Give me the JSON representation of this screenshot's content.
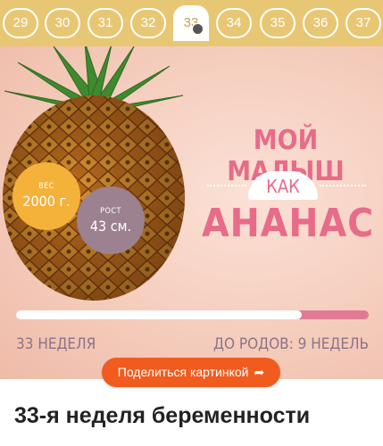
{
  "weeks": {
    "items": [
      "29",
      "30",
      "31",
      "32",
      "33",
      "34",
      "35",
      "36",
      "37"
    ],
    "active": "33"
  },
  "card": {
    "weight": {
      "label": "ВЕС",
      "value": "2000 г."
    },
    "height": {
      "label": "РОСТ",
      "value": "43 см."
    },
    "headline_line1": "МОЙ МАЛЫШ",
    "headline_like": "КАК",
    "headline_fruit": "АНАНАС",
    "progress_fraction": 0.81,
    "week_text": "33 НЕДЕЛЯ",
    "due_text": "ДО РОДОВ: 9 НЕДЕЛЬ"
  },
  "share_button": {
    "label": "Поделиться картинкой",
    "icon": "share-arrow-icon"
  },
  "page_title": "33-я неделя беременности",
  "colors": {
    "week_bar": "#e8c774",
    "accent_pink": "#e86b8a",
    "weight_bubble": "#f4b23a",
    "height_bubble": "#9c8190",
    "share_button": "#f05c1e"
  }
}
